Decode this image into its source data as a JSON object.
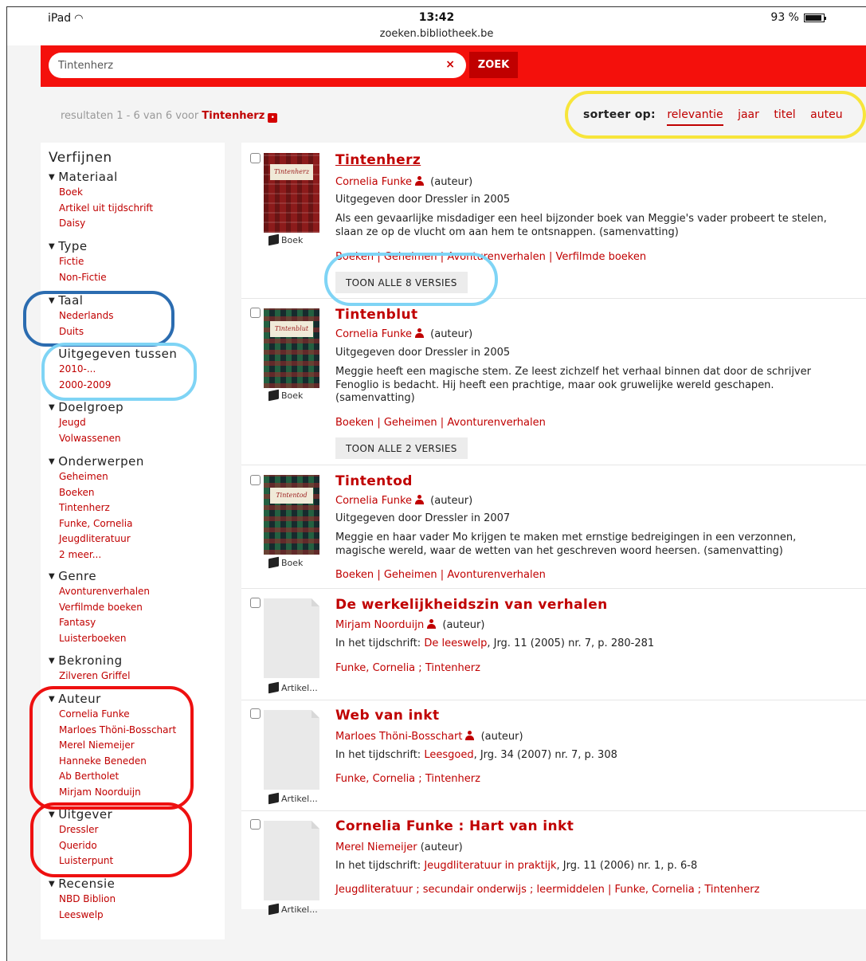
{
  "status": {
    "device": "iPad",
    "time": "13:42",
    "url": "zoeken.bibliotheek.be",
    "battery": "93 %",
    "battery_level": 0.93
  },
  "search": {
    "value": "Tintenherz",
    "button": "ZOEK",
    "clear": "×"
  },
  "results_summary": {
    "text": "resultaten 1 - 6 van 6 voor",
    "query": "Tintenherz"
  },
  "sort": {
    "label": "sorteer op:",
    "options": [
      "relevantie",
      "jaar",
      "titel",
      "auteu"
    ],
    "active": "relevantie"
  },
  "refine": {
    "title": "Verfijnen",
    "groups": [
      {
        "name": "Materiaal",
        "items": [
          "Boek",
          "Artikel uit tijdschrift",
          "Daisy"
        ]
      },
      {
        "name": "Type",
        "items": [
          "Fictie",
          "Non-Fictie"
        ]
      },
      {
        "name": "Taal",
        "items": [
          "Nederlands",
          "Duits"
        ]
      },
      {
        "name": "Uitgegeven tussen",
        "items": [
          "2010-...",
          "2000-2009"
        ]
      },
      {
        "name": "Doelgroep",
        "items": [
          "Jeugd",
          "Volwassenen"
        ]
      },
      {
        "name": "Onderwerpen",
        "items": [
          "Geheimen",
          "Boeken",
          "Tintenherz",
          "Funke, Cornelia",
          "Jeugdliteratuur",
          "2 meer..."
        ]
      },
      {
        "name": "Genre",
        "items": [
          "Avonturenverhalen",
          "Verfilmde boeken",
          "Fantasy",
          "Luisterboeken"
        ]
      },
      {
        "name": "Bekroning",
        "items": [
          "Zilveren Griffel"
        ]
      },
      {
        "name": "Auteur",
        "items": [
          "Cornelia Funke",
          "Marloes Thöni-Bosschart",
          "Merel Niemeijer",
          "Hanneke Beneden",
          "Ab Bertholet",
          "Mirjam Noorduijn"
        ]
      },
      {
        "name": "Uitgever",
        "items": [
          "Dressler",
          "Querido",
          "Luisterpunt"
        ]
      },
      {
        "name": "Recensie",
        "items": [
          "NBD Biblion",
          "Leeswelp"
        ]
      }
    ]
  },
  "results": [
    {
      "title": "Tintenherz",
      "cover_text": "Tintenherz",
      "author": "Cornelia Funke",
      "role": "(auteur)",
      "published": "Uitgegeven door Dressler in 2005",
      "description": "Als een gevaarlijke misdadiger een heel bijzonder boek van Meggie's vader probeert te stelen, slaan ze op de vlucht om aan hem te ontsnappen. (samenvatting)",
      "subjects": [
        "Boeken",
        "Geheimen",
        "Avonturenverhalen",
        "Verfilmde boeken"
      ],
      "subject_sep": " | ",
      "material": "Boek",
      "versions": "TOON ALLE 8 VERSIES"
    },
    {
      "title": "Tintenblut",
      "cover_text": "Tintenblut",
      "author": "Cornelia Funke",
      "role": "(auteur)",
      "published": "Uitgegeven door Dressler in 2005",
      "description": "Meggie heeft een magische stem. Ze leest zichzelf het verhaal binnen dat door de schrijver Fenoglio is bedacht. Hij heeft een prachtige, maar ook gruwelijke wereld geschapen. (samenvatting)",
      "subjects": [
        "Boeken",
        "Geheimen",
        "Avonturenverhalen"
      ],
      "subject_sep": " | ",
      "material": "Boek",
      "versions": "TOON ALLE 2 VERSIES"
    },
    {
      "title": "Tintentod",
      "cover_text": "Tintentod",
      "author": "Cornelia Funke",
      "role": "(auteur)",
      "published": "Uitgegeven door Dressler in 2007",
      "description": "Meggie en haar vader Mo krijgen te maken met ernstige bedreigingen in een verzonnen, magische wereld, waar de wetten van het geschreven woord heersen. (samenvatting)",
      "subjects": [
        "Boeken",
        "Geheimen",
        "Avonturenverhalen"
      ],
      "subject_sep": " | ",
      "material": "Boek"
    },
    {
      "title": "De werkelijkheidszin van verhalen",
      "author": "Mirjam Noorduijn",
      "role": "(auteur)",
      "journal_prefix": "In het tijdschrift:",
      "journal": "De leeswelp",
      "journal_suffix": ", Jrg. 11 (2005) nr. 7, p. 280-281",
      "subjects": [
        "Funke, Cornelia",
        "Tintenherz"
      ],
      "subject_sep": " ; ",
      "material": "Artikel..."
    },
    {
      "title": "Web van inkt",
      "author": "Marloes Thöni-Bosschart",
      "role": "(auteur)",
      "journal_prefix": "In het tijdschrift:",
      "journal": "Leesgoed",
      "journal_suffix": ", Jrg. 34 (2007) nr. 7, p. 308",
      "subjects": [
        "Funke, Cornelia",
        "Tintenherz"
      ],
      "subject_sep": " ; ",
      "material": "Artikel..."
    },
    {
      "title": "Cornelia Funke : Hart van inkt",
      "author": "Merel Niemeijer",
      "role": "(auteur)",
      "journal_prefix": "In het tijdschrift:",
      "journal": "Jeugdliteratuur in praktijk",
      "journal_suffix": ", Jrg. 11 (2006) nr. 1, p. 6-8",
      "subjects_text": "Jeugdliteratuur ; secundair onderwijs ; leermiddelen | Funke, Cornelia ; Tintenherz",
      "material": "Artikel..."
    }
  ],
  "annotation_colors": {
    "yellow": "#f7e53a",
    "dark_blue": "#2b6cb0",
    "light_blue": "#7fd4f5",
    "red": "#ee1010"
  }
}
